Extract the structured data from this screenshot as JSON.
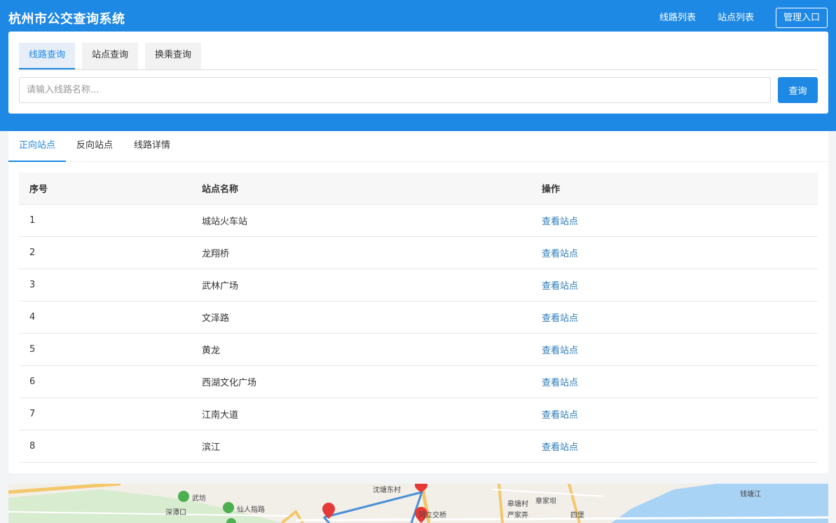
{
  "header": {
    "title": "杭州市公交查询系统",
    "nav": [
      "线路列表",
      "站点列表"
    ],
    "admin_label": "管理入口"
  },
  "search": {
    "tabs": [
      "线路查询",
      "站点查询",
      "换乘查询"
    ],
    "active_tab": 0,
    "placeholder": "请输入线路名称...",
    "value": "",
    "button_label": "查询"
  },
  "result": {
    "tabs": [
      "正向站点",
      "反向站点",
      "线路详情"
    ],
    "active_tab": 0,
    "columns": [
      "序号",
      "站点名称",
      "操作"
    ],
    "rows": [
      {
        "index": "1",
        "name": "城站火车站",
        "action": "查看站点"
      },
      {
        "index": "2",
        "name": "龙翔桥",
        "action": "查看站点"
      },
      {
        "index": "3",
        "name": "武林广场",
        "action": "查看站点"
      },
      {
        "index": "4",
        "name": "文泽路",
        "action": "查看站点"
      },
      {
        "index": "5",
        "name": "黄龙",
        "action": "查看站点"
      },
      {
        "index": "6",
        "name": "西湖文化广场",
        "action": "查看站点"
      },
      {
        "index": "7",
        "name": "江南大道",
        "action": "查看站点"
      },
      {
        "index": "8",
        "name": "滨江",
        "action": "查看站点"
      }
    ]
  },
  "map": {
    "labels": [
      "武坊",
      "深潭口",
      "仙人指路",
      "沈塘东村",
      "河立交桥",
      "皋塘村",
      "章家坝",
      "严家弄",
      "四堡",
      "钱塘江"
    ],
    "colors": {
      "park": "#4caf50",
      "water": "#a9d3f5",
      "route": "#4a8fd6",
      "marker": "#e53935",
      "road": "#f5c76b"
    }
  },
  "colors": {
    "primary": "#1e88e5",
    "link": "#2b7bb9"
  }
}
